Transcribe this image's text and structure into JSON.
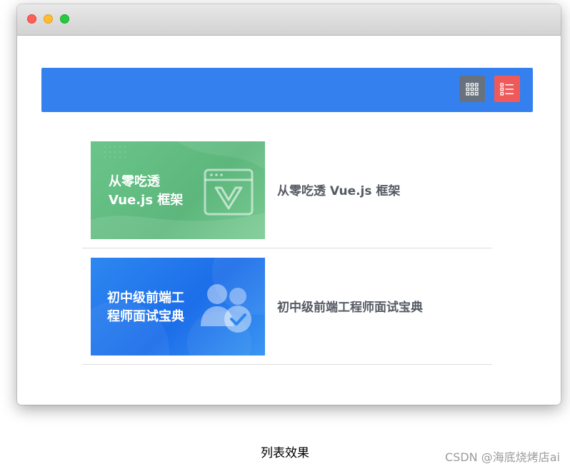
{
  "window": {
    "controls": [
      "close",
      "minimize",
      "zoom"
    ]
  },
  "toolbar": {
    "buttons": [
      {
        "icon": "grid-view-icon",
        "color": "#68727e"
      },
      {
        "icon": "list-view-icon",
        "color": "#f0595a",
        "active": true
      }
    ],
    "background": "#3480ef"
  },
  "items": [
    {
      "thumb_lines": [
        "从零吃透",
        "Vue.js 框架"
      ],
      "title": "从零吃透 Vue.js 框架",
      "thumb_color": "#6ac58a"
    },
    {
      "thumb_lines": [
        "初中级前端工",
        "程师面试宝典"
      ],
      "title": "初中级前端工程师面试宝典",
      "thumb_color": "#2d87f0"
    }
  ],
  "caption": "列表效果",
  "watermark": "CSDN @海底烧烤店ai"
}
